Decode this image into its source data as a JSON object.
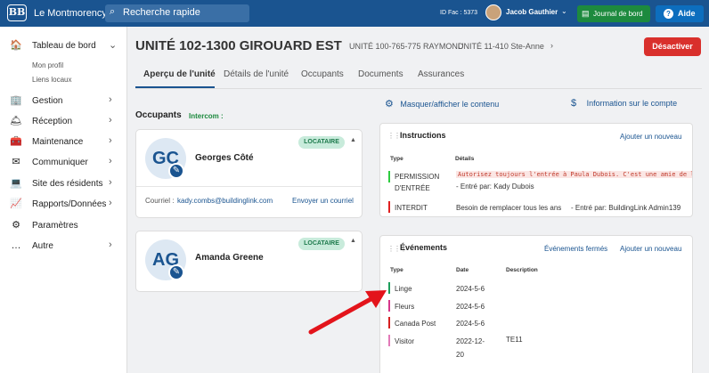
{
  "topbar": {
    "logo_text": "BB",
    "building": "Le Montmorency",
    "search_placeholder": "Recherche rapide",
    "id_fac": "ID Fac : 5373",
    "user": "Jacob Gauthier",
    "journal_btn": "Journal de bord",
    "help_btn": "Aide"
  },
  "sidebar": {
    "items": [
      {
        "label": "Tableau de bord",
        "icon": "home-icon",
        "glyph": "🏠"
      },
      {
        "label": "Gestion",
        "icon": "building-icon",
        "glyph": "🏢"
      },
      {
        "label": "Réception",
        "icon": "bell-icon",
        "glyph": "🛎"
      },
      {
        "label": "Maintenance",
        "icon": "toolbox-icon",
        "glyph": "🧰"
      },
      {
        "label": "Communiquer",
        "icon": "mail-icon",
        "glyph": "✉"
      },
      {
        "label": "Site des résidents",
        "icon": "computer-icon",
        "glyph": "💻"
      },
      {
        "label": "Rapports/Données",
        "icon": "chart-icon",
        "glyph": "📈"
      },
      {
        "label": "Paramètres",
        "icon": "gear-icon",
        "glyph": "⚙"
      },
      {
        "label": "Autre",
        "icon": "more-icon",
        "glyph": "…"
      }
    ],
    "sub_items": [
      "Mon profil",
      "Liens locaux"
    ]
  },
  "unit": {
    "title": "UNITÉ 102-1300 GIROUARD EST",
    "prev_unit": "UNITÉ 100-765-775 RAYMOND",
    "next_unit": "UNITÉ 11-410 Ste-Anne",
    "deactivate": "Désactiver"
  },
  "tabs": [
    "Aperçu de l'unité",
    "Détails de l'unité",
    "Occupants",
    "Documents",
    "Assurances"
  ],
  "occupants": {
    "title": "Occupants",
    "intercom": "Intercom :",
    "cards": [
      {
        "initials": "GC",
        "name": "Georges Côté",
        "badge": "LOCATAIRE",
        "email_label": "Courriel :",
        "email": "kady.combs@buildinglink.com",
        "action": "Envoyer un courriel"
      },
      {
        "initials": "AG",
        "name": "Amanda Greene",
        "badge": "LOCATAIRE"
      }
    ]
  },
  "right": {
    "toggle": "Masquer/afficher le contenu",
    "account": "Information sur le compte",
    "instructions": {
      "title": "Instructions",
      "add": "Ajouter un nouveau",
      "col_type": "Type",
      "col_details": "Détails",
      "rows": [
        {
          "type_line1": "PERMISSION",
          "type_line2": "D'ENTRÉE",
          "highlight": "Autorisez toujours l'entrée à Paula Dubois. C'est une amie de la famille",
          "entered": "- Entré par: Kady Dubois",
          "color": "#2ecc40"
        },
        {
          "type_line1": "INTERDIT",
          "detail": "Besoin de remplacer tous les ans",
          "entered": "- Entré par: BuildingLink Admin139",
          "color": "#e02020"
        }
      ]
    },
    "events": {
      "title": "Événements",
      "closed": "Événements fermés",
      "add": "Ajouter un nouveau",
      "col_type": "Type",
      "col_date": "Date",
      "col_desc": "Description",
      "rows": [
        {
          "type": "Linge",
          "date": "2024-5-6",
          "desc": "",
          "color": "#1d9e5c"
        },
        {
          "type": "Fleurs",
          "date": "2024-5-6",
          "desc": "",
          "color": "#d6368a"
        },
        {
          "type": "Canada Post",
          "date": "2024-5-6",
          "desc": "",
          "color": "#d61f1f"
        },
        {
          "type": "Visitor",
          "date_line1": "2022-12-",
          "date_line2": "20",
          "desc": "TE11",
          "color": "#e27ab8"
        }
      ]
    }
  }
}
